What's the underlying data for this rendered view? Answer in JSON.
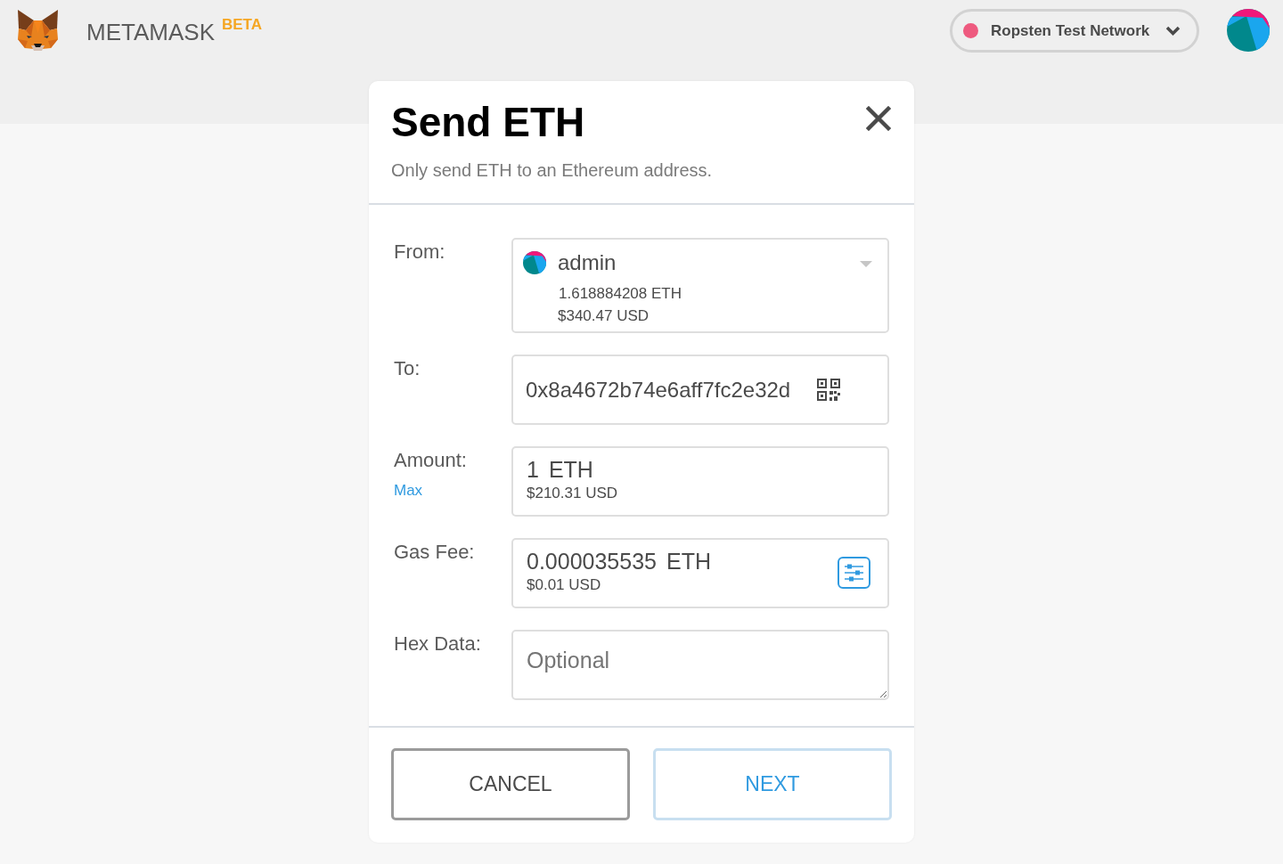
{
  "header": {
    "logo": "METAMASK",
    "badge": "BETA",
    "network": {
      "name": "Ropsten Test Network",
      "color": "#ee5a7f"
    }
  },
  "modal": {
    "title": "Send ETH",
    "subtitle": "Only send ETH to an Ethereum address."
  },
  "fields": [
    {
      "kind": "account",
      "label": "From:",
      "account": "admin",
      "balance": "1.618884208",
      "unit": "ETH",
      "fiat": "$340.47 USD"
    },
    {
      "kind": "address",
      "label": "To:",
      "value": "0x8a4672b74e6aff7fc2e32d"
    },
    {
      "kind": "amount",
      "label": "Amount:",
      "link": "Max",
      "value": "1",
      "unit": "ETH",
      "fiat": "$210.31 USD"
    },
    {
      "kind": "fee",
      "label": "Gas Fee:",
      "value": "0.000035535",
      "unit": "ETH",
      "fiat": "$0.01 USD"
    },
    {
      "kind": "hex",
      "label": "Hex Data:",
      "placeholder": "Optional"
    }
  ],
  "buttons": [
    {
      "kind": "secondary",
      "label": "CANCEL"
    },
    {
      "kind": "primary",
      "label": "NEXT"
    }
  ]
}
